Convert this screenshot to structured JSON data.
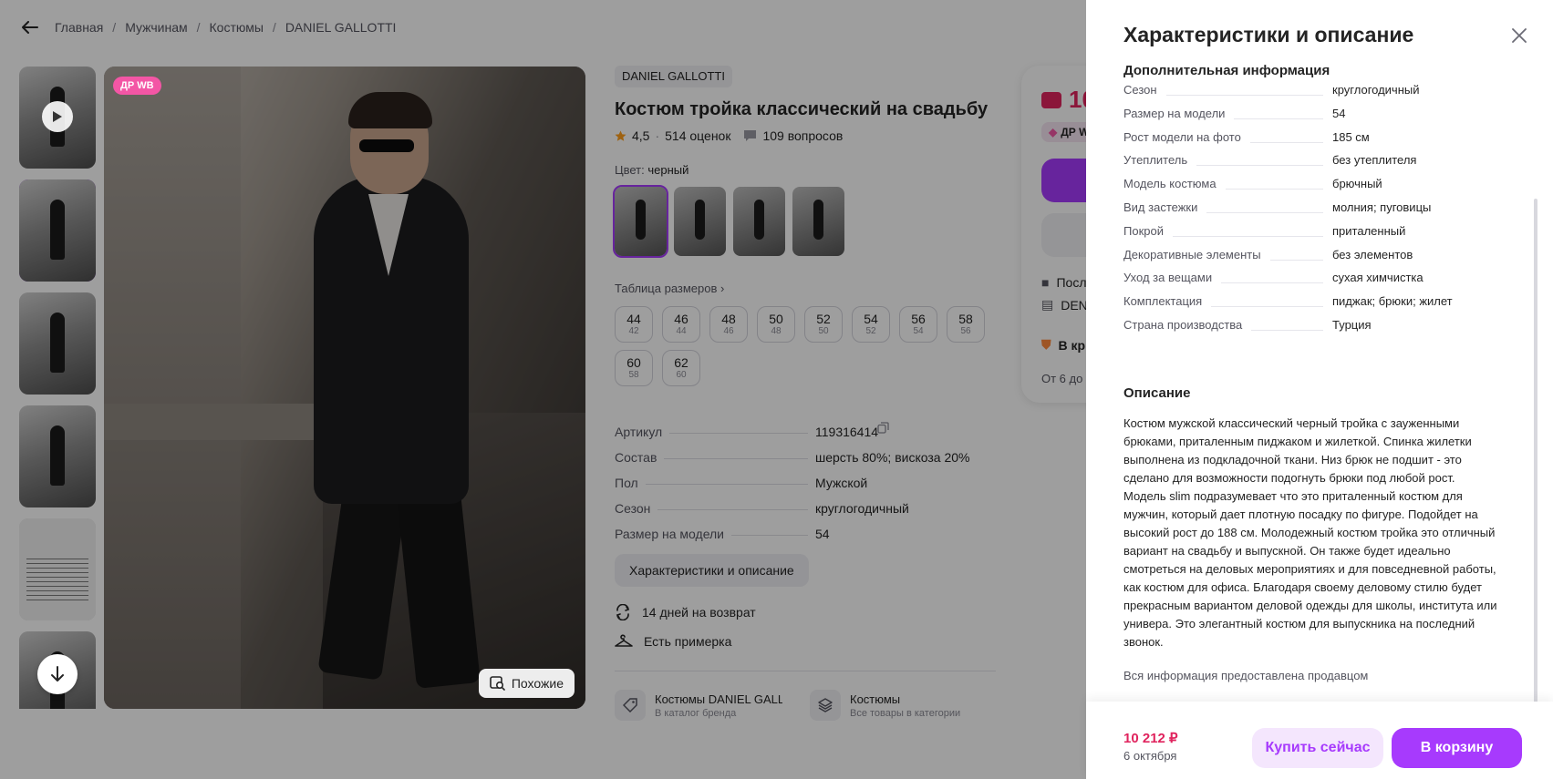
{
  "breadcrumbs": [
    "Главная",
    "Мужчинам",
    "Костюмы",
    "DANIEL GALLOTTI"
  ],
  "gallery": {
    "badge": "ДР WB",
    "similar_label": "Похожие"
  },
  "product": {
    "brand": "DANIEL GALLOTTI",
    "title": "Костюм тройка классический на свадьбу",
    "rating": "4,5",
    "reviews": "514 оценок",
    "questions": "109 вопросов",
    "color_label": "Цвет:",
    "color_value": "черный",
    "size_table_link": "Таблица размеров",
    "sizes": [
      {
        "size": "44",
        "ru": "42"
      },
      {
        "size": "46",
        "ru": "44"
      },
      {
        "size": "48",
        "ru": "46"
      },
      {
        "size": "50",
        "ru": "48"
      },
      {
        "size": "52",
        "ru": "50"
      },
      {
        "size": "54",
        "ru": "52"
      },
      {
        "size": "56",
        "ru": "54"
      },
      {
        "size": "58",
        "ru": "56"
      },
      {
        "size": "60",
        "ru": "58"
      },
      {
        "size": "62",
        "ru": "60"
      }
    ],
    "params": [
      {
        "key": "Артикул",
        "value": "119316414"
      },
      {
        "key": "Состав",
        "value": "шерсть 80%; вискоза 20%"
      },
      {
        "key": "Пол",
        "value": "Мужской"
      },
      {
        "key": "Сезон",
        "value": "круглогодичный"
      },
      {
        "key": "Размер на модели",
        "value": "54"
      }
    ],
    "characteristics_button": "Характеристики и описание",
    "features": [
      "14 дней на возврат",
      "Есть примерка"
    ],
    "categories": [
      {
        "title": "Костюмы DANIEL GALLOTTI",
        "sub": "В каталог бренда"
      },
      {
        "title": "Костюмы",
        "sub": "Все товары в категории"
      }
    ]
  },
  "buybox": {
    "price_partial": "10",
    "badge_partial": "ДР W",
    "line1": "Посл",
    "line2": "DEN",
    "stock_partial": "В кр",
    "delivery_partial": "От 6 до"
  },
  "drawer": {
    "title": "Характеристики и описание",
    "additional_title": "Дополнительная информация",
    "characteristics": [
      {
        "key": "Сезон",
        "value": "круглогодичный"
      },
      {
        "key": "Размер на модели",
        "value": "54"
      },
      {
        "key": "Рост модели на фото",
        "value": "185 см"
      },
      {
        "key": "Утеплитель",
        "value": "без утеплителя"
      },
      {
        "key": "Модель костюма",
        "value": "брючный"
      },
      {
        "key": "Вид застежки",
        "value": "молния; пуговицы"
      },
      {
        "key": "Покрой",
        "value": "приталенный"
      },
      {
        "key": "Декоративные элементы",
        "value": "без элементов"
      },
      {
        "key": "Уход за вещами",
        "value": "сухая химчистка"
      },
      {
        "key": "Комплектация",
        "value": "пиджак; брюки; жилет"
      },
      {
        "key": "Страна производства",
        "value": "Турция"
      }
    ],
    "description_title": "Описание",
    "description": "Костюм мужской классический черный тройка с зауженными брюками, приталенным пиджаком и жилеткой. Спинка жилетки выполнена из подкладочной ткани. Низ брюк не подшит - это сделано для возможности подогнуть брюки под любой рост. Модель slim подразумевает что это приталенный костюм для мужчин, который дает плотную посадку по фигуре. Подойдет на высокий рост до 188 см. Молодежный костюм тройка это отличный вариант на свадьбу и выпускной. Он также будет идеально смотреться на деловых мероприятиях и для повседневной работы, как костюм для офиса. Благодаря своему деловому стилю будет прекрасным вариантом деловой одежды для школы, института или универа. Это элегантный костюм для выпускника на последний звонок.",
    "seller_note": "Вся информация предоставлена продавцом",
    "footer": {
      "price": "10 212 ₽",
      "date": "6 октября",
      "buy_now": "Купить сейчас",
      "to_cart": "В корзину"
    }
  },
  "colors": {
    "accent": "#a73afd",
    "price": "#e0245e",
    "badge": "#f356a5"
  }
}
